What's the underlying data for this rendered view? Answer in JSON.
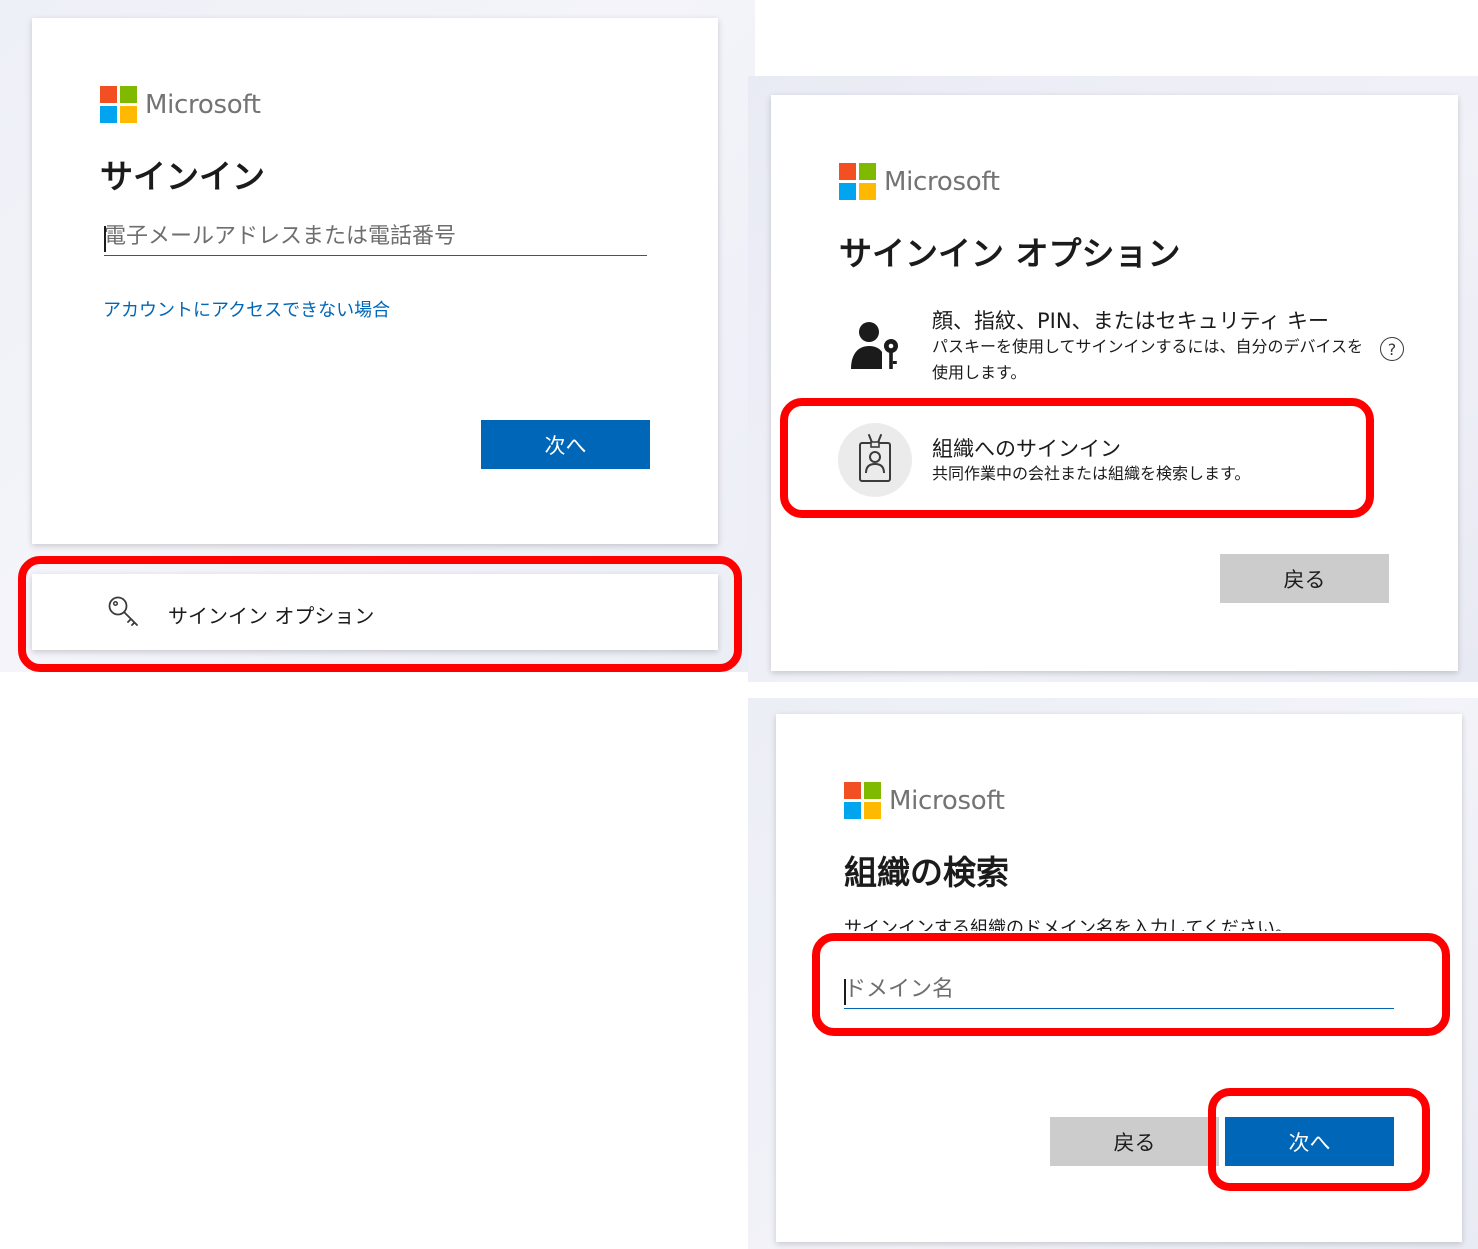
{
  "brand": {
    "name": "Microsoft",
    "colors": {
      "red": "#f25022",
      "green": "#7fba00",
      "blue": "#00a4ef",
      "yellow": "#ffb900",
      "accent": "#0067b8",
      "highlight": "#ff0000"
    }
  },
  "signin": {
    "title": "サインイン",
    "email_placeholder": "電子メールアドレスまたは電話番号",
    "cant_access_link": "アカウントにアクセスできない場合",
    "next_label": "次へ"
  },
  "signin_options_entry": {
    "icon": "key-icon",
    "label": "サインイン オプション"
  },
  "options_page": {
    "title": "サインイン オプション",
    "passkey": {
      "icon": "person-key-icon",
      "title": "顔、指紋、PIN、またはセキュリティ キー",
      "description": "パスキーを使用してサインインするには、自分のデバイスを使用します。",
      "help_icon": "help-icon"
    },
    "org": {
      "icon": "badge-icon",
      "title": "組織へのサインイン",
      "description": "共同作業中の会社または組織を検索します。"
    },
    "back_label": "戻る"
  },
  "org_search": {
    "title": "組織の検索",
    "instruction": "サインインする組織のドメイン名を入力してください。",
    "domain_placeholder": "ドメイン名",
    "back_label": "戻る",
    "next_label": "次へ"
  }
}
